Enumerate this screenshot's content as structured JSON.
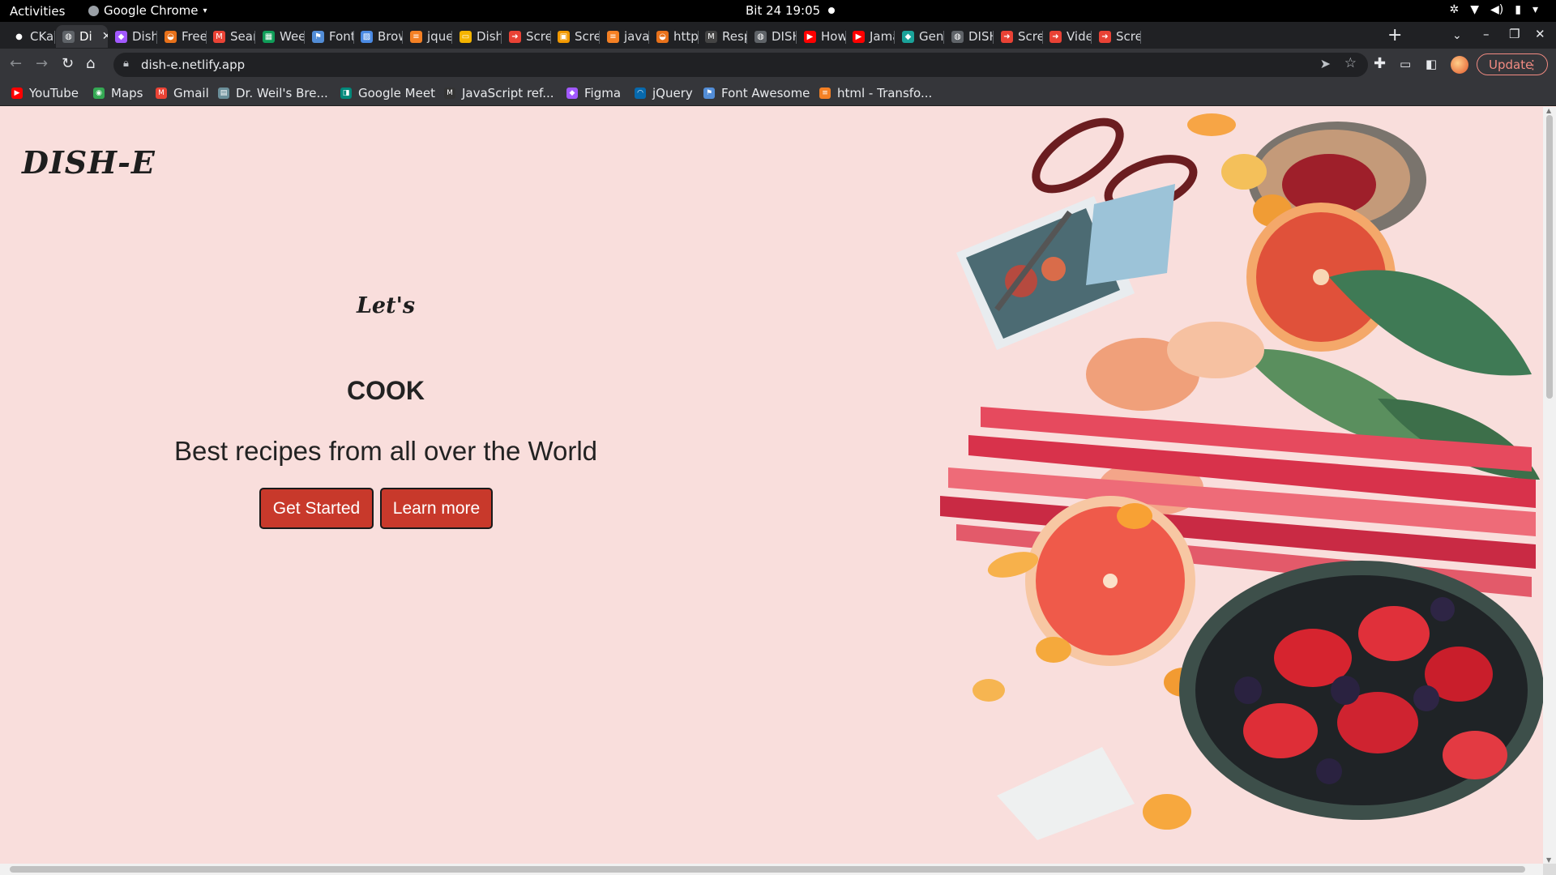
{
  "system_bar": {
    "activities": "Activities",
    "app_name": "Google Chrome",
    "clock": "Bit 24  19:05"
  },
  "tabs": [
    {
      "label": "CKav",
      "icon": "github-icon",
      "color": "#202124"
    },
    {
      "label": "Di",
      "icon": "globe-icon",
      "color": "#5f6368",
      "active": true
    },
    {
      "label": "Dish",
      "icon": "figma-icon",
      "color": "#a259ff"
    },
    {
      "label": "Free",
      "icon": "food-icon",
      "color": "#e8711a"
    },
    {
      "label": "Searc",
      "icon": "gmail-icon",
      "color": "#ea4335"
    },
    {
      "label": "Weel",
      "icon": "sheets-icon",
      "color": "#0f9d58"
    },
    {
      "label": "Font",
      "icon": "flag-icon",
      "color": "#528dd7"
    },
    {
      "label": "Brow",
      "icon": "mdn-icon",
      "color": "#4a8ae4"
    },
    {
      "label": "jquer",
      "icon": "stackoverflow-icon",
      "color": "#f48024"
    },
    {
      "label": "Dish",
      "icon": "slides-icon",
      "color": "#f4b400"
    },
    {
      "label": "Scree",
      "icon": "screencast-icon",
      "color": "#e94235"
    },
    {
      "label": "Scre",
      "icon": "image-icon",
      "color": "#f29900"
    },
    {
      "label": "javas",
      "icon": "stackoverflow-icon",
      "color": "#f48024"
    },
    {
      "label": "http",
      "icon": "food-icon",
      "color": "#e8711a"
    },
    {
      "label": "Resp",
      "icon": "medium-icon",
      "color": "#444"
    },
    {
      "label": "DISH",
      "icon": "globe-icon",
      "color": "#5f6368"
    },
    {
      "label": "How",
      "icon": "youtube-icon",
      "color": "#ff0000"
    },
    {
      "label": "Jama",
      "icon": "youtube-icon",
      "color": "#ff0000"
    },
    {
      "label": "Gene",
      "icon": "diamond-icon",
      "color": "#1aa39a"
    },
    {
      "label": "DISH",
      "icon": "globe-icon",
      "color": "#5f6368"
    },
    {
      "label": "Scree",
      "icon": "screencast-icon",
      "color": "#e94235"
    },
    {
      "label": "Vide",
      "icon": "screencast-icon",
      "color": "#e94235"
    },
    {
      "label": "Scre",
      "icon": "screencast-icon",
      "color": "#e94235"
    }
  ],
  "toolbar": {
    "url": "dish-e.netlify.app",
    "update_label": "Update"
  },
  "bookmarks": [
    {
      "label": "YouTube",
      "icon": "youtube-icon",
      "color": "#ff0000"
    },
    {
      "label": "Maps",
      "icon": "maps-icon",
      "color": "#34a853"
    },
    {
      "label": "Gmail",
      "icon": "gmail-icon",
      "color": "#ea4335"
    },
    {
      "label": "Dr. Weil's Bre...",
      "icon": "bookmark-icon",
      "color": "#6b8f9a"
    },
    {
      "label": "Google Meet",
      "icon": "meet-icon",
      "color": "#00897b"
    },
    {
      "label": "JavaScript ref...",
      "icon": "mdn-icon",
      "color": "#333"
    },
    {
      "label": "Figma",
      "icon": "figma-icon",
      "color": "#a259ff"
    },
    {
      "label": "jQuery",
      "icon": "jquery-icon",
      "color": "#0769ad"
    },
    {
      "label": "Font Awesome",
      "icon": "flag-icon",
      "color": "#528dd7"
    },
    {
      "label": "html - Transfo...",
      "icon": "stackoverflow-icon",
      "color": "#f48024"
    }
  ],
  "page": {
    "logo": "DISH-E",
    "lets": "Let's",
    "cook": "COOK",
    "tagline": "Best recipes from all over the World",
    "get_started": "Get Started",
    "learn_more": "Learn more",
    "background_color": "#f9dedc",
    "button_color": "#c8392b"
  }
}
